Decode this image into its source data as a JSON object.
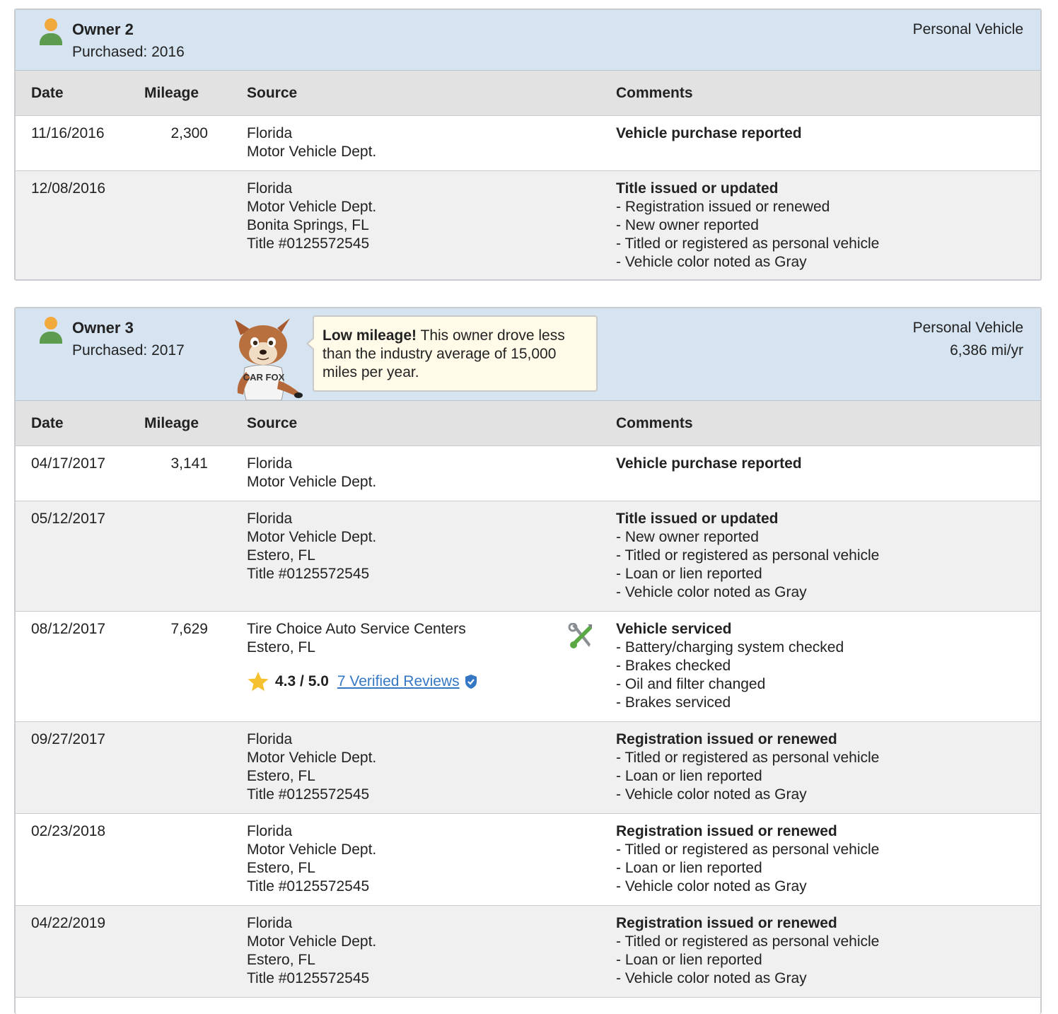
{
  "columns": {
    "date": "Date",
    "mileage": "Mileage",
    "source": "Source",
    "comments": "Comments"
  },
  "owner2": {
    "name": "Owner 2",
    "purchased": "Purchased: 2016",
    "type": "Personal Vehicle",
    "rows": [
      {
        "date": "11/16/2016",
        "mileage": "2,300",
        "source": [
          "Florida",
          "Motor Vehicle Dept."
        ],
        "comment_title": "Vehicle purchase reported",
        "comments": []
      },
      {
        "date": "12/08/2016",
        "mileage": "",
        "source": [
          "Florida",
          "Motor Vehicle Dept.",
          "Bonita Springs, FL",
          "Title #0125572545"
        ],
        "comment_title": "Title issued or updated",
        "comments": [
          "- Registration issued or renewed",
          "- New owner reported",
          "- Titled or registered as personal vehicle",
          "- Vehicle color noted as Gray"
        ]
      }
    ]
  },
  "owner3": {
    "name": "Owner 3",
    "purchased": "Purchased: 2017",
    "type": "Personal Vehicle",
    "rate": "6,386 mi/yr",
    "tooltip": {
      "bold": "Low mileage!",
      "text": " This owner drove less than the industry average of 15,000 miles per year."
    },
    "mascot_text": "CAR FOX",
    "rows": [
      {
        "date": "04/17/2017",
        "mileage": "3,141",
        "source": [
          "Florida",
          "Motor Vehicle Dept."
        ],
        "comment_title": "Vehicle purchase reported",
        "comments": []
      },
      {
        "date": "05/12/2017",
        "mileage": "",
        "source": [
          "Florida",
          "Motor Vehicle Dept.",
          "Estero, FL",
          "Title #0125572545"
        ],
        "comment_title": "Title issued or updated",
        "comments": [
          "- New owner reported",
          "- Titled or registered as personal vehicle",
          "- Loan or lien reported",
          "- Vehicle color noted as Gray"
        ]
      },
      {
        "date": "08/12/2017",
        "mileage": "7,629",
        "source": [
          "Tire Choice Auto Service Centers",
          "Estero, FL"
        ],
        "rating": {
          "score": "4.3 / 5.0",
          "reviews": "7 Verified Reviews"
        },
        "comment_title": "Vehicle serviced",
        "comments": [
          "- Battery/charging system checked",
          "- Brakes checked",
          "- Oil and filter changed",
          "- Brakes serviced"
        ]
      },
      {
        "date": "09/27/2017",
        "mileage": "",
        "source": [
          "Florida",
          "Motor Vehicle Dept.",
          "Estero, FL",
          "Title #0125572545"
        ],
        "comment_title": "Registration issued or renewed",
        "comments": [
          "- Titled or registered as personal vehicle",
          "- Loan or lien reported",
          "- Vehicle color noted as Gray"
        ]
      },
      {
        "date": "02/23/2018",
        "mileage": "",
        "source": [
          "Florida",
          "Motor Vehicle Dept.",
          "Estero, FL",
          "Title #0125572545"
        ],
        "comment_title": "Registration issued or renewed",
        "comments": [
          "- Titled or registered as personal vehicle",
          "- Loan or lien reported",
          "- Vehicle color noted as Gray"
        ]
      },
      {
        "date": "04/22/2019",
        "mileage": "",
        "source": [
          "Florida",
          "Motor Vehicle Dept.",
          "Estero, FL",
          "Title #0125572545"
        ],
        "comment_title": "Registration issued or renewed",
        "comments": [
          "- Titled or registered as personal vehicle",
          "- Loan or lien reported",
          "- Vehicle color noted as Gray"
        ]
      }
    ]
  },
  "colors": {
    "header_bg": "#d6e3f1",
    "col_head_bg": "#e2e2e2",
    "row_gray": "#f0f0f0",
    "link": "#3477c4",
    "tooltip_bg": "#fffbe8"
  }
}
